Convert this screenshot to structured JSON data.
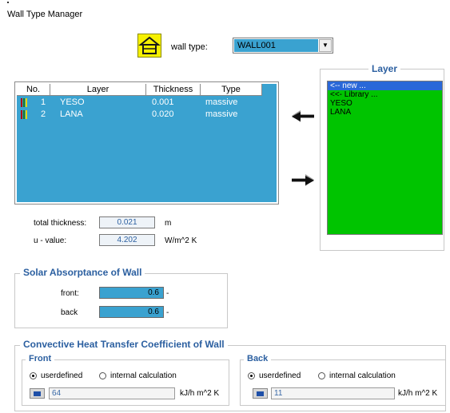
{
  "window": {
    "title": "Wall Type Manager"
  },
  "wall_type": {
    "label": "wall type:",
    "value": "WALL001"
  },
  "layer_table": {
    "headers": [
      "No.",
      "Layer",
      "Thickness",
      "Type"
    ],
    "rows": [
      {
        "no": "1",
        "layer": "YESO",
        "thickness": "0.001",
        "type": "massive"
      },
      {
        "no": "2",
        "layer": "LANA",
        "thickness": "0.020",
        "type": "massive"
      }
    ]
  },
  "layer_library": {
    "title": "Layer",
    "items": [
      "<-- new ...",
      "<<- Library ...",
      "YESO",
      "LANA"
    ]
  },
  "totals": {
    "thickness_label": "total thickness:",
    "thickness_value": "0.021",
    "thickness_unit": "m",
    "u_label": "u - value:",
    "u_value": "4.202",
    "u_unit": "W/m^2 K"
  },
  "solar": {
    "title": "Solar Absorptance of Wall",
    "front_label": "front:",
    "front_value": "0.6",
    "front_unit": "-",
    "back_label": "back",
    "back_value": "0.6",
    "back_unit": "-"
  },
  "convective": {
    "title": "Convective Heat Transfer Coefficient of Wall",
    "front": {
      "title": "Front",
      "opt_user": "userdefined",
      "opt_internal": "internal calculation",
      "value": "64",
      "unit": "kJ/h m^2 K"
    },
    "back": {
      "title": "Back",
      "opt_user": "userdefined",
      "opt_internal": "internal calculation",
      "value": "11",
      "unit": "kJ/h m^2 K"
    }
  }
}
